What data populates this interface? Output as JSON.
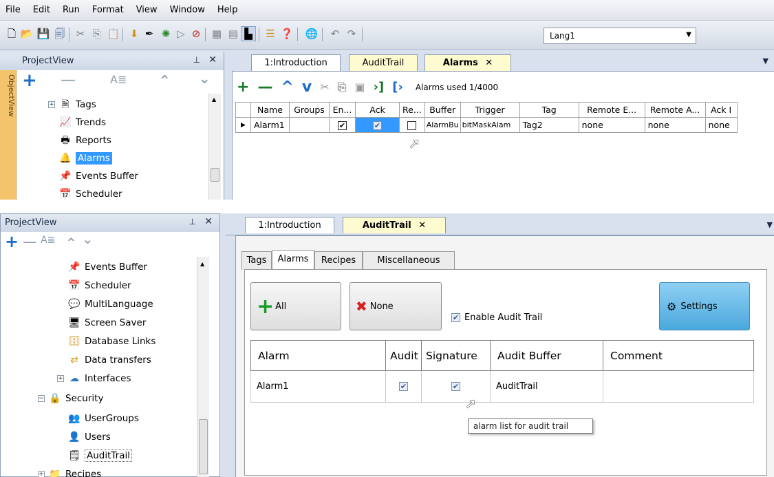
{
  "menu": [
    "File",
    "Edit",
    "Run",
    "Format",
    "View",
    "Window",
    "Help"
  ],
  "toolbar": {
    "language": "Lang1"
  },
  "top": {
    "project_view": {
      "title": "ProjectView",
      "object_view_label": "ObjectView",
      "items": [
        "Tags",
        "Trends",
        "Reports",
        "Alarms",
        "Events Buffer",
        "Scheduler"
      ]
    },
    "tabs": [
      "1:Introduction",
      "AuditTrail",
      "Alarms"
    ],
    "alarms_used": "Alarms used 1/4000",
    "grid": {
      "columns": [
        "Name",
        "Groups",
        "En...",
        "Ack",
        "Re...",
        "Buffer",
        "Trigger",
        "Tag",
        "Remote E...",
        "Remote A...",
        "Ack I"
      ],
      "row": {
        "name": "Alarm1",
        "buffer": "AlarmBu",
        "trigger": "bitMaskAlam",
        "tag": "Tag2",
        "remote_e": "none",
        "remote_a": "none",
        "ack_i": "none"
      }
    }
  },
  "bottom": {
    "project_view": {
      "title": "ProjectView",
      "items": [
        "Events Buffer",
        "Scheduler",
        "MultiLanguage",
        "Screen Saver",
        "Database Links",
        "Data transfers",
        "Interfaces",
        "Security",
        "UserGroups",
        "Users",
        "AuditTrail",
        "Recipes"
      ]
    },
    "tabs": [
      "1:Introduction",
      "AuditTrail"
    ],
    "subtabs": [
      "Tags",
      "Alarms",
      "Recipes",
      "Miscellaneous"
    ],
    "buttons": {
      "all": "All",
      "none": "None",
      "settings": "Settings"
    },
    "enable_audit_label": "Enable Audit Trail",
    "table": {
      "headers": [
        "Alarm",
        "Audit",
        "Signature",
        "Audit Buffer",
        "Comment"
      ],
      "row": {
        "alarm": "Alarm1",
        "audit_buffer": "AuditTrail",
        "comment": ""
      }
    },
    "tooltip": "alarm list for audit trail"
  },
  "colors": {
    "selection": "#3399ff",
    "active_tab": "#fffbd0",
    "settings_button": "#5eb4e4",
    "add_green": "#1a9a2a",
    "add_blue": "#1c6cc8"
  }
}
